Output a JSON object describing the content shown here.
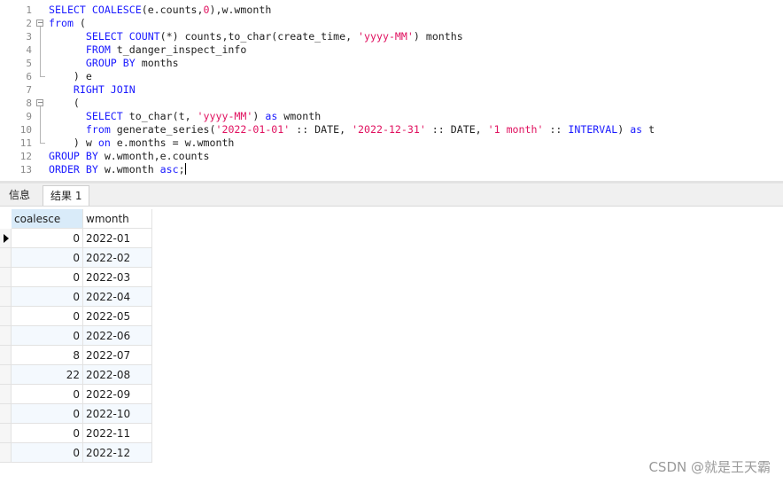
{
  "editor": {
    "line_numbers": [
      "1",
      "2",
      "3",
      "4",
      "5",
      "6",
      "7",
      "8",
      "9",
      "10",
      "11",
      "12",
      "13"
    ],
    "lines": [
      [
        {
          "t": "kw",
          "v": "SELECT "
        },
        {
          "t": "fn",
          "v": "COALESCE"
        },
        {
          "t": "id",
          "v": "(e.counts,"
        },
        {
          "t": "num",
          "v": "0"
        },
        {
          "t": "id",
          "v": "),w.wmonth"
        }
      ],
      [
        {
          "t": "kw",
          "v": "from "
        },
        {
          "t": "id",
          "v": "("
        }
      ],
      [
        {
          "t": "id",
          "v": "      "
        },
        {
          "t": "kw",
          "v": "SELECT "
        },
        {
          "t": "fn",
          "v": "COUNT"
        },
        {
          "t": "id",
          "v": "(*) counts,to_char(create_time, "
        },
        {
          "t": "str",
          "v": "'yyyy-MM'"
        },
        {
          "t": "id",
          "v": ") months"
        }
      ],
      [
        {
          "t": "id",
          "v": "      "
        },
        {
          "t": "kw",
          "v": "FROM "
        },
        {
          "t": "id",
          "v": "t_danger_inspect_info"
        }
      ],
      [
        {
          "t": "id",
          "v": "      "
        },
        {
          "t": "kw",
          "v": "GROUP BY "
        },
        {
          "t": "id",
          "v": "months"
        }
      ],
      [
        {
          "t": "id",
          "v": "    ) e"
        }
      ],
      [
        {
          "t": "id",
          "v": "    "
        },
        {
          "t": "kw",
          "v": "RIGHT JOIN"
        }
      ],
      [
        {
          "t": "id",
          "v": "    ("
        }
      ],
      [
        {
          "t": "id",
          "v": "      "
        },
        {
          "t": "kw",
          "v": "SELECT "
        },
        {
          "t": "id",
          "v": "to_char(t, "
        },
        {
          "t": "str",
          "v": "'yyyy-MM'"
        },
        {
          "t": "id",
          "v": ") "
        },
        {
          "t": "kw",
          "v": "as "
        },
        {
          "t": "id",
          "v": "wmonth"
        }
      ],
      [
        {
          "t": "id",
          "v": "      "
        },
        {
          "t": "kw",
          "v": "from "
        },
        {
          "t": "id",
          "v": "generate_series("
        },
        {
          "t": "str",
          "v": "'2022-01-01'"
        },
        {
          "t": "id",
          "v": " :: DATE, "
        },
        {
          "t": "str",
          "v": "'2022-12-31'"
        },
        {
          "t": "id",
          "v": " :: DATE, "
        },
        {
          "t": "str",
          "v": "'1 month'"
        },
        {
          "t": "id",
          "v": " :: "
        },
        {
          "t": "kw",
          "v": "INTERVAL"
        },
        {
          "t": "id",
          "v": ") "
        },
        {
          "t": "kw",
          "v": "as "
        },
        {
          "t": "id",
          "v": "t"
        }
      ],
      [
        {
          "t": "id",
          "v": "    ) w "
        },
        {
          "t": "kw",
          "v": "on "
        },
        {
          "t": "id",
          "v": "e.months = w.wmonth"
        }
      ],
      [
        {
          "t": "kw",
          "v": "GROUP BY "
        },
        {
          "t": "id",
          "v": "w.wmonth,e.counts"
        }
      ],
      [
        {
          "t": "kw",
          "v": "ORDER BY "
        },
        {
          "t": "id",
          "v": "w.wmonth "
        },
        {
          "t": "kw",
          "v": "asc"
        },
        {
          "t": "id",
          "v": ";"
        }
      ]
    ]
  },
  "tabs": {
    "info_label": "信息",
    "result_label": "结果 1"
  },
  "grid": {
    "columns": [
      "coalesce",
      "wmonth"
    ],
    "rows": [
      [
        "0",
        "2022-01"
      ],
      [
        "0",
        "2022-02"
      ],
      [
        "0",
        "2022-03"
      ],
      [
        "0",
        "2022-04"
      ],
      [
        "0",
        "2022-05"
      ],
      [
        "0",
        "2022-06"
      ],
      [
        "8",
        "2022-07"
      ],
      [
        "22",
        "2022-08"
      ],
      [
        "0",
        "2022-09"
      ],
      [
        "0",
        "2022-10"
      ],
      [
        "0",
        "2022-11"
      ],
      [
        "0",
        "2022-12"
      ]
    ]
  },
  "watermark": "CSDN @就是王天霸"
}
